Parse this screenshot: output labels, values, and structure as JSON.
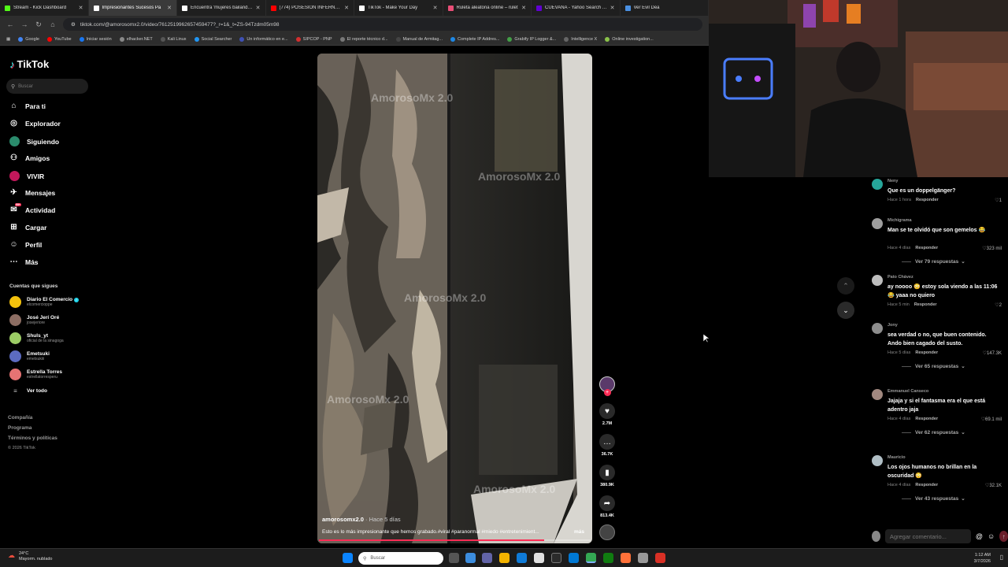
{
  "browser": {
    "tabs": [
      {
        "title": "Stream - Kick Dashboard",
        "color": "#53fc18"
      },
      {
        "title": "Impresionantes Sucesos Pa",
        "color": "#ffffff",
        "active": true
      },
      {
        "title": "Encuentra 'mujeres bailando' e",
        "color": "#ffffff"
      },
      {
        "title": "(774) POSESION INFERNAL: EV",
        "color": "#ff0000"
      },
      {
        "title": "TikTok - Make Your Day",
        "color": "#ffffff"
      },
      {
        "title": "Ruleta aleatoria online – rulet",
        "color": "#e94e77"
      },
      {
        "title": "CUEVANA - Yahoo Search Tus",
        "color": "#6001d2"
      },
      {
        "title": "Ver Evil Dea",
        "color": "#4a90e2"
      }
    ],
    "url": "tiktok.com/@amorosomx2.0/video/7612519962657459477?_r=1&_t=ZS-94Tzdm05m98",
    "bookmarks": [
      {
        "label": "Google",
        "color": "#4285f4"
      },
      {
        "label": "YouTube",
        "color": "#ff0000"
      },
      {
        "label": "Iniciar sesión",
        "color": "#1877f2"
      },
      {
        "label": "elhacker.NET",
        "color": "#888888"
      },
      {
        "label": "Kali Linux",
        "color": "#555555"
      },
      {
        "label": "Social Searcher",
        "color": "#2196f3"
      },
      {
        "label": "Un informático en e...",
        "color": "#3f51b5"
      },
      {
        "label": "SIPCOP - PNP",
        "color": "#d32f2f"
      },
      {
        "label": "El reporte técnico d...",
        "color": "#777777"
      },
      {
        "label": "Manual de Armitag...",
        "color": "#444444"
      },
      {
        "label": "Complete IP Addres...",
        "color": "#1e88e5"
      },
      {
        "label": "Grabify IP Logger &...",
        "color": "#43a047"
      },
      {
        "label": "Intelligence X",
        "color": "#666666"
      },
      {
        "label": "Online investigation...",
        "color": "#8bc34a"
      }
    ]
  },
  "tiktok": {
    "logo": "TikTok",
    "search_placeholder": "Buscar",
    "nav": [
      {
        "label": "Para ti",
        "icon": "home-icon"
      },
      {
        "label": "Explorador",
        "icon": "compass-icon"
      },
      {
        "label": "Siguiendo",
        "icon": "following-icon"
      },
      {
        "label": "Amigos",
        "icon": "friends-icon"
      },
      {
        "label": "VIVIR",
        "icon": "live-icon"
      },
      {
        "label": "Mensajes",
        "icon": "messages-icon"
      },
      {
        "label": "Actividad",
        "icon": "activity-icon",
        "badge": "99+"
      },
      {
        "label": "Cargar",
        "icon": "upload-icon"
      },
      {
        "label": "Perfil",
        "icon": "profile-icon"
      },
      {
        "label": "Más",
        "icon": "more-icon"
      }
    ],
    "following_title": "Cuentas que sigues",
    "following": [
      {
        "name": "Diario El Comercio",
        "handle": "elcomercioppe",
        "color": "#f4c20d",
        "verified": true
      },
      {
        "name": "José Jerí Oré",
        "handle": "josejeriore",
        "color": "#8d6e63"
      },
      {
        "name": "Shuls_yt",
        "handle": "oficial de la sinagoga",
        "color": "#9ccc65"
      },
      {
        "name": "Emetsuki",
        "handle": "emetsukiii",
        "color": "#5c6bc0"
      },
      {
        "name": "Estrella Torres",
        "handle": "estrellatorresperu",
        "color": "#e57373"
      }
    ],
    "see_all": "Ver todo",
    "footer": [
      "Compañía",
      "Programa",
      "Términos y políticas",
      "© 2026 TikTok"
    ]
  },
  "video": {
    "watermark": "AmorosoMx 2.0",
    "author": "amorosomx2.0",
    "time": "· Hace 5 días",
    "caption": "Esto es lo más impresionante que hemos grabado.#viral #paranormal #miedo #entretenimient...",
    "more": "más",
    "progress": 0.83,
    "actions": {
      "likes": "2.7M",
      "comments": "36.7K",
      "saves": "380.9K",
      "shares": "813.4K"
    }
  },
  "comments": [
    {
      "user": "Neny",
      "text": "Que es un doppelgänger?",
      "time": "Hace 1 hora",
      "reply": "Responder",
      "likes": "1",
      "color": "#26a69a"
    },
    {
      "user": "Michigrama",
      "text": "Man se te olvidó que son gemelos 😂",
      "time": "Hace 4 días",
      "reply": "Responder",
      "likes": "323 mil",
      "more": "Ver 79 respuestas",
      "color": "#9e9e9e"
    },
    {
      "user": "Pato Chávez",
      "text": "ay noooo 😳 estoy sola viendo a las 11:06 😂 yaaa no quiero",
      "time": "Hace 5 min",
      "reply": "Responder",
      "likes": "2",
      "color": "#bdbdbd"
    },
    {
      "user": "Jony",
      "text": "sea verdad o no, que buen contenido. Ando bien cagado del susto.",
      "time": "Hace 5 días",
      "reply": "Responder",
      "likes": "147.3K",
      "more": "Ver 65 respuestas",
      "color": "#8d8d8d"
    },
    {
      "user": "Emmanuel Canseco",
      "text": "Jajaja y si el fantasma era el que está adentro jaja",
      "time": "Hace 4 días",
      "reply": "Responder",
      "likes": "69.1 mil",
      "more": "Ver 62 respuestas",
      "color": "#a1887f"
    },
    {
      "user": "Mauricio",
      "text": "Los ojos humanos no brillan en la oscuridad 😳",
      "time": "Hace 4 días",
      "reply": "Responder",
      "likes": "32.1K",
      "more": "Ver 43 respuestas",
      "color": "#b0bec5"
    }
  ],
  "comment_input_placeholder": "Agregar comentario...",
  "taskbar": {
    "weather_temp": "24°C",
    "weather_desc": "Mayorm. nublado",
    "search_placeholder": "Buscar",
    "time": "1:12 AM",
    "date": "3/7/2026"
  }
}
